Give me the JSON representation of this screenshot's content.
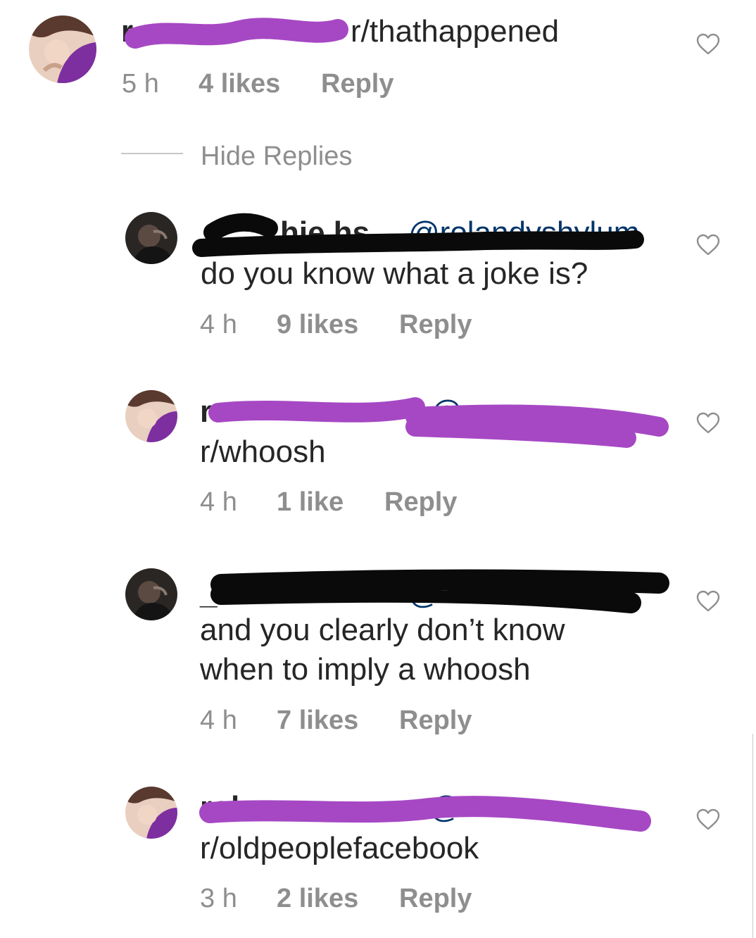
{
  "comments": [
    {
      "avatar": "user-avatar-purple",
      "username_visible": "r",
      "text": "r/thathappened",
      "time": "5 h",
      "likes": "4 likes",
      "reply": "Reply"
    },
    {
      "avatar": "user-avatar-dark",
      "username_visible": "hie hs",
      "mention_visible": "@rolandyshylum",
      "text": "do you know what a joke is?",
      "time": "4 h",
      "likes": "9 likes",
      "reply": "Reply"
    },
    {
      "avatar": "user-avatar-purple",
      "username_visible": "r",
      "mention_visible": "@",
      "text": "r/whoosh",
      "time": "4 h",
      "likes": "1 like",
      "reply": "Reply"
    },
    {
      "avatar": "user-avatar-dark",
      "username_visible": "_",
      "mention_visible": "@",
      "text_line1": "and you clearly don’t know",
      "text_line2": "when to imply a whoosh",
      "time": "4 h",
      "likes": "7 likes",
      "reply": "Reply"
    },
    {
      "avatar": "user-avatar-purple",
      "username_visible": "rolan",
      "mention_visible": "@",
      "text": "r/oldpeoplefacebook",
      "time": "3 h",
      "likes": "2 likes",
      "reply": "Reply"
    }
  ],
  "thread": {
    "hide_replies": "Hide Replies"
  },
  "colors": {
    "text": "#262626",
    "meta": "#8e8e8e",
    "mention": "#003569",
    "redaction_purple": "#a648c4",
    "redaction_black": "#0a0a0a"
  },
  "icons": [
    "heart-outline-icon"
  ]
}
